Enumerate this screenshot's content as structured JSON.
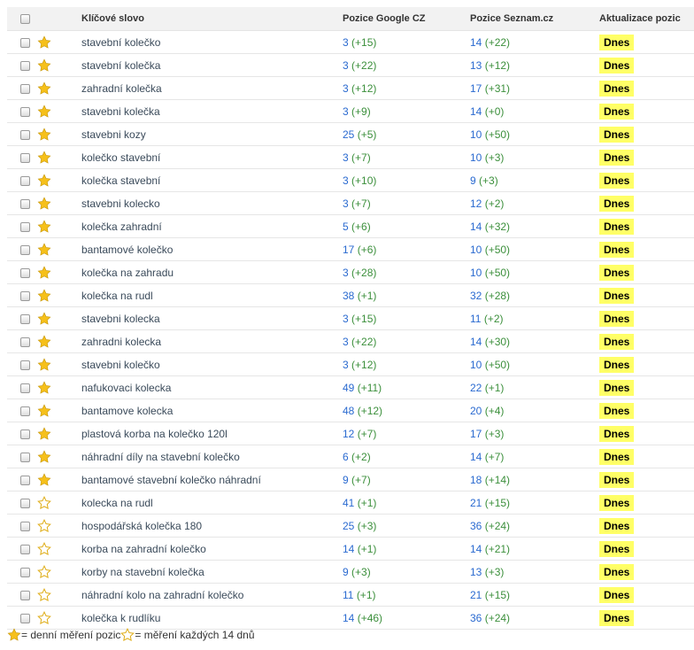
{
  "header": {
    "keyword": "Klíčové slovo",
    "google": "Pozice Google CZ",
    "seznam": "Pozice Seznam.cz",
    "update": "Aktualizace pozic"
  },
  "colors": {
    "star_fill": "#f6c01a",
    "badge": "#ffff66",
    "link": "#2a6ad0",
    "positive_change": "#3b8f3b"
  },
  "icons": {
    "star_filled": "star-filled-icon",
    "star_outline": "star-outline-icon",
    "checkbox": "checkbox-icon"
  },
  "rows": [
    {
      "keyword": "stavební kolečko",
      "starred": true,
      "google_pos": "3",
      "google_chg": "(+15)",
      "seznam_pos": "14",
      "seznam_chg": "(+22)",
      "update": "Dnes"
    },
    {
      "keyword": "stavební kolečka",
      "starred": true,
      "google_pos": "3",
      "google_chg": "(+22)",
      "seznam_pos": "13",
      "seznam_chg": "(+12)",
      "update": "Dnes"
    },
    {
      "keyword": "zahradní kolečka",
      "starred": true,
      "google_pos": "3",
      "google_chg": "(+12)",
      "seznam_pos": "17",
      "seznam_chg": "(+31)",
      "update": "Dnes"
    },
    {
      "keyword": "stavebni kolečka",
      "starred": true,
      "google_pos": "3",
      "google_chg": "(+9)",
      "seznam_pos": "14",
      "seznam_chg": "(+0)",
      "update": "Dnes"
    },
    {
      "keyword": "stavebni kozy",
      "starred": true,
      "google_pos": "25",
      "google_chg": "(+5)",
      "seznam_pos": "10",
      "seznam_chg": "(+50)",
      "update": "Dnes"
    },
    {
      "keyword": "kolečko stavební",
      "starred": true,
      "google_pos": "3",
      "google_chg": "(+7)",
      "seznam_pos": "10",
      "seznam_chg": "(+3)",
      "update": "Dnes"
    },
    {
      "keyword": "kolečka stavební",
      "starred": true,
      "google_pos": "3",
      "google_chg": "(+10)",
      "seznam_pos": "9",
      "seznam_chg": "(+3)",
      "update": "Dnes"
    },
    {
      "keyword": "stavebni kolecko",
      "starred": true,
      "google_pos": "3",
      "google_chg": "(+7)",
      "seznam_pos": "12",
      "seznam_chg": "(+2)",
      "update": "Dnes"
    },
    {
      "keyword": "kolečka zahradní",
      "starred": true,
      "google_pos": "5",
      "google_chg": "(+6)",
      "seznam_pos": "14",
      "seznam_chg": "(+32)",
      "update": "Dnes"
    },
    {
      "keyword": "bantamové kolečko",
      "starred": true,
      "google_pos": "17",
      "google_chg": "(+6)",
      "seznam_pos": "10",
      "seznam_chg": "(+50)",
      "update": "Dnes"
    },
    {
      "keyword": "kolečka na zahradu",
      "starred": true,
      "google_pos": "3",
      "google_chg": "(+28)",
      "seznam_pos": "10",
      "seznam_chg": "(+50)",
      "update": "Dnes"
    },
    {
      "keyword": "kolečka na rudl",
      "starred": true,
      "google_pos": "38",
      "google_chg": "(+1)",
      "seznam_pos": "32",
      "seznam_chg": "(+28)",
      "update": "Dnes"
    },
    {
      "keyword": "stavebni kolecka",
      "starred": true,
      "google_pos": "3",
      "google_chg": "(+15)",
      "seznam_pos": "11",
      "seznam_chg": "(+2)",
      "update": "Dnes"
    },
    {
      "keyword": "zahradni kolecka",
      "starred": true,
      "google_pos": "3",
      "google_chg": "(+22)",
      "seznam_pos": "14",
      "seznam_chg": "(+30)",
      "update": "Dnes"
    },
    {
      "keyword": "stavebni kolečko",
      "starred": true,
      "google_pos": "3",
      "google_chg": "(+12)",
      "seznam_pos": "10",
      "seznam_chg": "(+50)",
      "update": "Dnes"
    },
    {
      "keyword": "nafukovaci kolecka",
      "starred": true,
      "google_pos": "49",
      "google_chg": "(+11)",
      "seznam_pos": "22",
      "seznam_chg": "(+1)",
      "update": "Dnes"
    },
    {
      "keyword": "bantamove kolecka",
      "starred": true,
      "google_pos": "48",
      "google_chg": "(+12)",
      "seznam_pos": "20",
      "seznam_chg": "(+4)",
      "update": "Dnes"
    },
    {
      "keyword": "plastová korba na kolečko 120l",
      "starred": true,
      "google_pos": "12",
      "google_chg": "(+7)",
      "seznam_pos": "17",
      "seznam_chg": "(+3)",
      "update": "Dnes"
    },
    {
      "keyword": "náhradní díly na stavební kolečko",
      "starred": true,
      "google_pos": "6",
      "google_chg": "(+2)",
      "seznam_pos": "14",
      "seznam_chg": "(+7)",
      "update": "Dnes"
    },
    {
      "keyword": "bantamové stavební kolečko náhradní",
      "starred": true,
      "google_pos": "9",
      "google_chg": "(+7)",
      "seznam_pos": "18",
      "seznam_chg": "(+14)",
      "update": "Dnes"
    },
    {
      "keyword": "kolecka na rudl",
      "starred": false,
      "google_pos": "41",
      "google_chg": "(+1)",
      "seznam_pos": "21",
      "seznam_chg": "(+15)",
      "update": "Dnes"
    },
    {
      "keyword": "hospodářská kolečka 180",
      "starred": false,
      "google_pos": "25",
      "google_chg": "(+3)",
      "seznam_pos": "36",
      "seznam_chg": "(+24)",
      "update": "Dnes"
    },
    {
      "keyword": "korba na zahradní kolečko",
      "starred": false,
      "google_pos": "14",
      "google_chg": "(+1)",
      "seznam_pos": "14",
      "seznam_chg": "(+21)",
      "update": "Dnes"
    },
    {
      "keyword": "korby na stavební kolečka",
      "starred": false,
      "google_pos": "9",
      "google_chg": "(+3)",
      "seznam_pos": "13",
      "seznam_chg": "(+3)",
      "update": "Dnes"
    },
    {
      "keyword": "náhradní kolo na zahradní kolečko",
      "starred": false,
      "google_pos": "11",
      "google_chg": "(+1)",
      "seznam_pos": "21",
      "seznam_chg": "(+15)",
      "update": "Dnes"
    },
    {
      "keyword": "kolečka k rudlíku",
      "starred": false,
      "google_pos": "14",
      "google_chg": "(+46)",
      "seznam_pos": "36",
      "seznam_chg": "(+24)",
      "update": "Dnes"
    }
  ],
  "legend": {
    "daily": " = denní měření pozic ",
    "biweekly": "= měření každých 14 dnů"
  }
}
